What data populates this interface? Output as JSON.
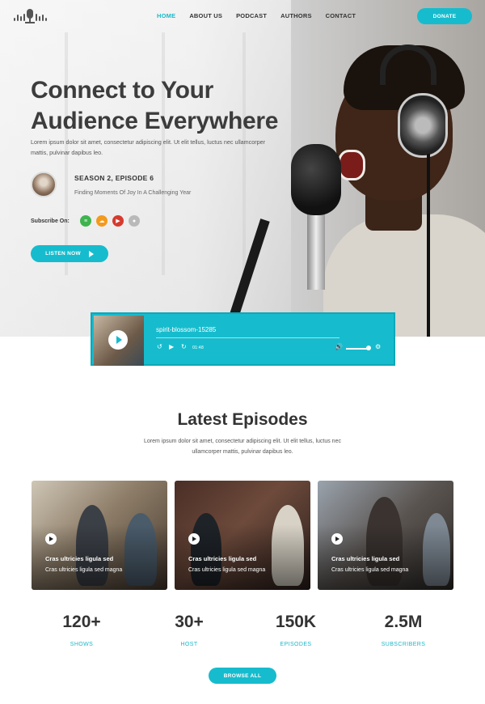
{
  "nav": {
    "items": [
      {
        "label": "HOME",
        "active": true
      },
      {
        "label": "ABOUT US",
        "active": false
      },
      {
        "label": "PODCAST",
        "active": false
      },
      {
        "label": "AUTHORS",
        "active": false
      },
      {
        "label": "CONTACT",
        "active": false
      }
    ],
    "donate_label": "DONATE"
  },
  "hero": {
    "title_line1": "Connect to Your",
    "title_line2": "Audience Everywhere",
    "description": "Lorem ipsum dolor sit amet, consectetur adipiscing elit. Ut elit tellus, luctus nec ullamcorper mattis, pulvinar dapibus leo.",
    "episode_title": "SEASON 2, EPISODE 6",
    "episode_subtitle": "Finding Moments Of Joy In A Challenging Year",
    "subscribe_label": "Subscribe On:",
    "subscribe_icons": [
      "spotify-icon",
      "soundcloud-icon",
      "youtube-icon",
      "apple-icon"
    ],
    "listen_label": "LISTEN NOW"
  },
  "player": {
    "track_name": "spirit-blossom-15285",
    "time": "01:48"
  },
  "episodes": {
    "title": "Latest Episodes",
    "description": "Lorem ipsum dolor sit amet, consectetur adipiscing elit. Ut elit tellus, luctus nec ullamcorper mattis, pulvinar dapibus leo.",
    "cards": [
      {
        "title": "Cras ultricies ligula sed",
        "subtitle": "Cras ultricies ligula sed magna"
      },
      {
        "title": "Cras ultricies ligula sed",
        "subtitle": "Cras ultricies ligula sed magna"
      },
      {
        "title": "Cras ultricies ligula sed",
        "subtitle": "Cras ultricies ligula sed magna"
      }
    ]
  },
  "stats": [
    {
      "value": "120+",
      "label": "SHOWS"
    },
    {
      "value": "30+",
      "label": "HOST"
    },
    {
      "value": "150K",
      "label": "EPISODES"
    },
    {
      "value": "2.5M",
      "label": "SUBSCRIBERS"
    }
  ],
  "browse_label": "BROWSE ALL",
  "colors": {
    "accent": "#16bccd",
    "heading": "#333333"
  }
}
